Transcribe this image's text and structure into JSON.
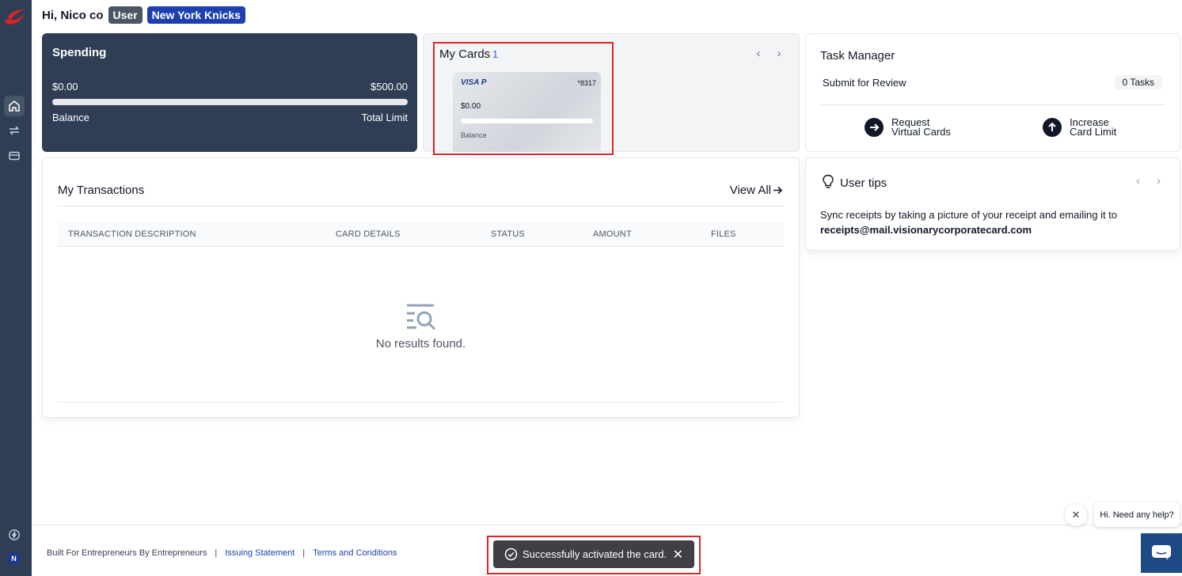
{
  "sidebar": {
    "logo_icon": "brand-swoosh-icon",
    "items": [
      {
        "icon": "home-icon",
        "active": true
      },
      {
        "icon": "transfer-arrows-icon",
        "active": false
      },
      {
        "icon": "credit-card-icon",
        "active": false
      }
    ],
    "bottom_icon": "lightning-icon",
    "avatar_initial": "N"
  },
  "header": {
    "greeting": "Hi, Nico co",
    "role_badge": "User",
    "team_badge": "New York Knicks"
  },
  "spending": {
    "title": "Spending",
    "spent": "$0.00",
    "limit": "$500.00",
    "progress": 0,
    "balance_label": "Balance",
    "limit_label": "Total Limit"
  },
  "my_cards": {
    "title": "My Cards",
    "count": "1",
    "card": {
      "brand": "VISA P",
      "last4": "*8317",
      "balance": "$0.00",
      "progress": 0,
      "balance_label": "Balance"
    }
  },
  "task_manager": {
    "title": "Task Manager",
    "submit_label": "Submit for Review",
    "tasks_count": "0 Tasks",
    "actions": [
      {
        "line1": "Request",
        "line2": "Virtual Cards"
      },
      {
        "line1": "Increase",
        "line2": "Card Limit"
      }
    ]
  },
  "transactions": {
    "title": "My Transactions",
    "view_all": "View All",
    "columns": [
      "TRANSACTION DESCRIPTION",
      "CARD DETAILS",
      "STATUS",
      "AMOUNT",
      "FILES"
    ],
    "empty_text": "No results found."
  },
  "user_tips": {
    "title": "User tips",
    "body": "Sync receipts by taking a picture of your receipt and emailing it to",
    "email": "receipts@mail.visionarycorporatecard.com"
  },
  "footer": {
    "tagline": "Built For Entrepreneurs By Entrepreneurs",
    "separator": "|",
    "links": [
      "Issuing Statement",
      "Terms and Conditions"
    ]
  },
  "toast": {
    "message": "Successfully activated the card.",
    "close": "✕"
  },
  "help": {
    "bubble_text": "Hi. Need any help?",
    "close": "✕"
  },
  "colors": {
    "sidebar": "#2f3e55",
    "accent_blue": "#1e40af",
    "highlight_red": "#dc2626",
    "toast_bg": "#3f3f46"
  }
}
